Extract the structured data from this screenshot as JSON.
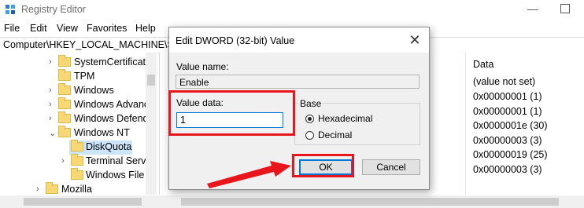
{
  "window": {
    "title": "Registry Editor",
    "menu": [
      "File",
      "Edit",
      "View",
      "Favorites",
      "Help"
    ],
    "address": "Computer\\HKEY_LOCAL_MACHINE\\SO"
  },
  "tree": [
    {
      "label": "SystemCertificate",
      "expander": "›",
      "selected": false
    },
    {
      "label": "TPM",
      "expander": "",
      "selected": false
    },
    {
      "label": "Windows",
      "expander": "›",
      "selected": false
    },
    {
      "label": "Windows Advanc",
      "expander": "›",
      "selected": false
    },
    {
      "label": "Windows Defende",
      "expander": "›",
      "selected": false
    },
    {
      "label": "Windows NT",
      "expander": "⌄",
      "selected": false
    },
    {
      "label": "DiskQuota",
      "expander": "",
      "selected": true
    },
    {
      "label": "Terminal Servic",
      "expander": "›",
      "selected": false
    },
    {
      "label": "Windows File P",
      "expander": "",
      "selected": false
    },
    {
      "label": "Mozilla",
      "expander": "›",
      "selected": false
    }
  ],
  "values_pane": {
    "data_header": "Data",
    "data": [
      "(value not set)",
      "0x00000001 (1)",
      "0x00000001 (1)",
      "0x0000001e (30)",
      "0x00000003 (3)",
      "0x00000019 (25)",
      "0x00000003 (3)"
    ]
  },
  "dialog": {
    "title": "Edit DWORD (32-bit) Value",
    "close_glyph": "✕",
    "value_name_label": "Value name:",
    "value_name": "Enable",
    "value_data_label": "Value data:",
    "value_data": "1",
    "base_label": "Base",
    "radio_hex": "Hexadecimal",
    "radio_dec": "Decimal",
    "selected_base": "Hexadecimal",
    "ok_label": "OK",
    "cancel_label": "Cancel"
  },
  "colors": {
    "annotation": "#e8161c",
    "selection": "#cce4f7",
    "accent": "#0078d7"
  }
}
